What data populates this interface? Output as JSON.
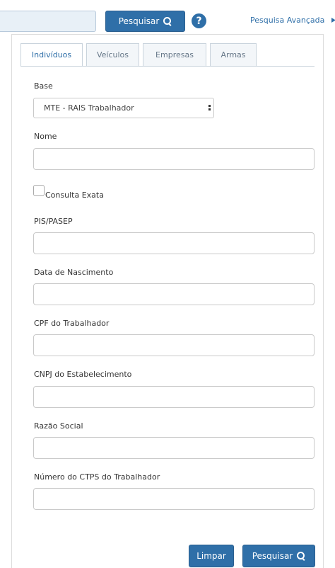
{
  "topbar": {
    "search_value": "",
    "search_button_label": "Pesquisar",
    "help_icon": "question-circle-icon",
    "advanced_link": "Pesquisa Avançada"
  },
  "tabs": [
    {
      "label": "Indivíduos",
      "active": true
    },
    {
      "label": "Veículos",
      "active": false
    },
    {
      "label": "Empresas",
      "active": false
    },
    {
      "label": "Armas",
      "active": false
    }
  ],
  "form": {
    "base_label": "Base",
    "base_value": "MTE - RAIS Trabalhador",
    "nome_label": "Nome",
    "nome_value": "",
    "exact_label": "Consulta Exata",
    "exact_checked": false,
    "pis_label": "PIS/PASEP",
    "pis_value": "",
    "nascimento_label": "Data de Nascimento",
    "nascimento_value": "",
    "cpf_label": "CPF do Trabalhador",
    "cpf_value": "",
    "cnpj_label": "CNPJ do Estabelecimento",
    "cnpj_value": "",
    "razao_label": "Razão Social",
    "razao_value": "",
    "ctps_label": "Número do CTPS do Trabalhador",
    "ctps_value": ""
  },
  "actions": {
    "clear_label": "Limpar",
    "search_label": "Pesquisar"
  },
  "colors": {
    "accent": "#2f6fa8"
  }
}
